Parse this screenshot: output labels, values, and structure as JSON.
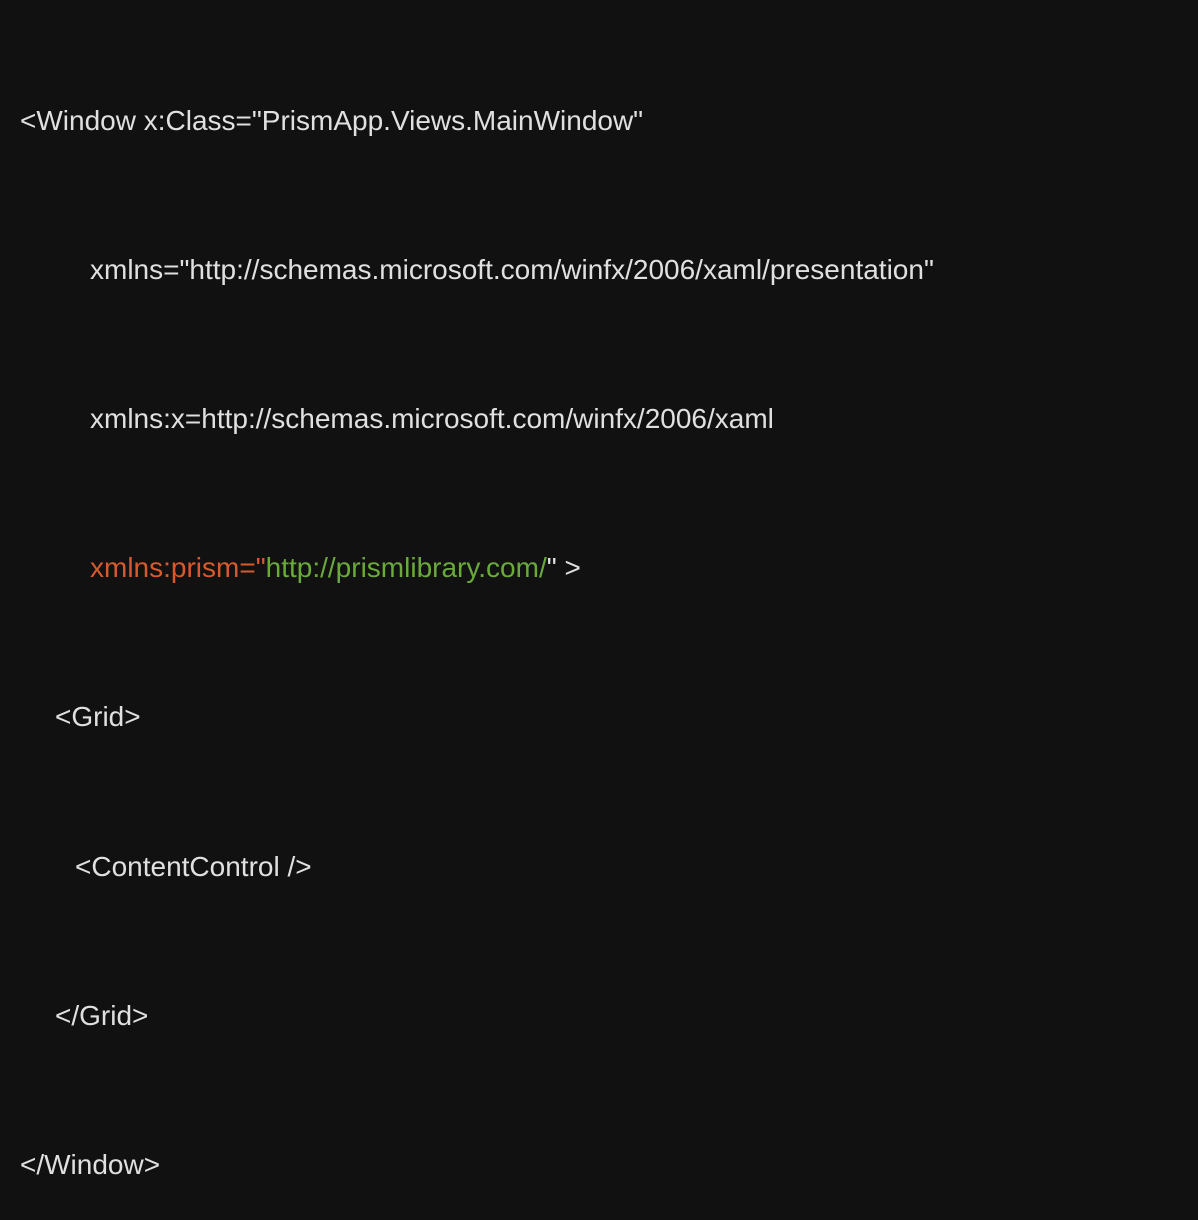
{
  "code": {
    "line1": "<Window x:Class=\"PrismApp.Views.MainWindow\"",
    "line2": "xmlns=\"http://schemas.microsoft.com/winfx/2006/xaml/presentation\"",
    "line3": "xmlns:x=http://schemas.microsoft.com/winfx/2006/xaml",
    "line4_part1": "xmlns:prism=\"",
    "line4_part2": "http://prismlibrary.com/",
    "line4_part3": "\" >",
    "line5": "<Grid>",
    "line6": "<ContentControl />",
    "line7": "</Grid>",
    "line8": "</Window>"
  }
}
